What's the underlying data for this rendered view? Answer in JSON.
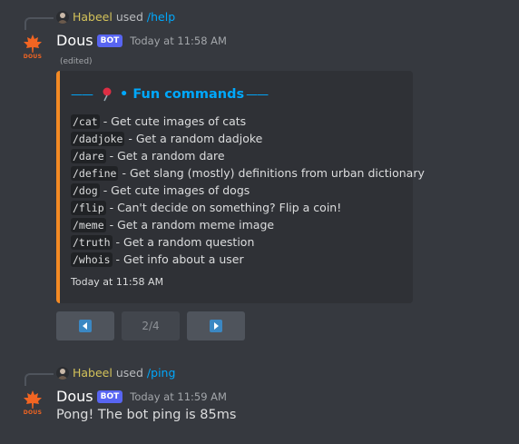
{
  "messages": [
    {
      "reply": {
        "user": "Habeel",
        "used": "used",
        "command": "/help"
      },
      "avatar_label": "DOUS",
      "author": "Dous",
      "bot_tag": "BOT",
      "timestamp": "Today at 11:58 AM",
      "edited": "(edited)",
      "embed": {
        "accent_color": "#f48a24",
        "title_icon": "pushpin-icon",
        "title_prefix": "——",
        "title": "• Fun commands",
        "title_suffix": "——",
        "commands": [
          {
            "cmd": "/cat",
            "desc": "- Get cute images of cats"
          },
          {
            "cmd": "/dadjoke",
            "desc": "- Get a random dadjoke"
          },
          {
            "cmd": "/dare",
            "desc": "- Get a random dare"
          },
          {
            "cmd": "/define",
            "desc": "- Get slang (mostly) definitions from urban dictionary"
          },
          {
            "cmd": "/dog",
            "desc": "- Get cute images of dogs"
          },
          {
            "cmd": "/flip",
            "desc": "- Can't decide on something? Flip a coin!"
          },
          {
            "cmd": "/meme",
            "desc": "- Get a random meme image"
          },
          {
            "cmd": "/truth",
            "desc": "- Get a random question"
          },
          {
            "cmd": "/whois",
            "desc": "- Get info about a user"
          }
        ],
        "footer": "Today at 11:58 AM"
      },
      "buttons": {
        "prev_icon": "arrow-left-icon",
        "page": "2/4",
        "next_icon": "arrow-right-icon"
      }
    },
    {
      "reply": {
        "user": "Habeel",
        "used": "used",
        "command": "/ping"
      },
      "avatar_label": "DOUS",
      "author": "Dous",
      "bot_tag": "BOT",
      "timestamp": "Today at 11:59 AM",
      "content": "Pong! The bot ping is 85ms"
    }
  ],
  "colors": {
    "background": "#36393f",
    "embed_bg": "#2f3136",
    "link": "#00a8fc",
    "bot_tag": "#5865f2",
    "reply_user": "#d4c35a"
  }
}
